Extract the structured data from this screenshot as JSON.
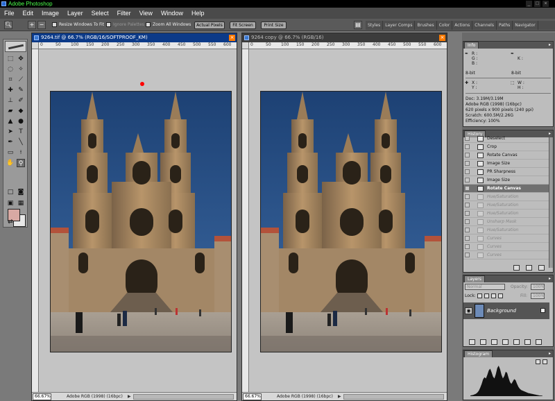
{
  "app": {
    "title": "Adobe Photoshop"
  },
  "menus": [
    "File",
    "Edit",
    "Image",
    "Layer",
    "Select",
    "Filter",
    "View",
    "Window",
    "Help"
  ],
  "options": {
    "resize_windows": "Resize Windows To Fit",
    "ignore_palettes": "Ignore Palettes",
    "zoom_all": "Zoom All Windows",
    "actual_pixels": "Actual Pixels",
    "fit_screen": "Fit Screen",
    "print_size": "Print Size"
  },
  "palette_well": [
    "Styles",
    "Layer Comps",
    "Brushes",
    "Color",
    "Actions",
    "Channels",
    "Paths",
    "Navigator"
  ],
  "docs": [
    {
      "title": "9264.tif @ 66.7% (RGB/16/SOFTPROOF_KM)",
      "zoom": "66.67%",
      "profile": "Adobe RGB (1998) (16bpc)",
      "ruler_ticks": [
        "0",
        "50",
        "100",
        "150",
        "200",
        "250",
        "300",
        "350",
        "400",
        "450",
        "500",
        "550",
        "600"
      ],
      "active": true
    },
    {
      "title": "9264 copy @ 66.7% (RGB/16)",
      "zoom": "66.67%",
      "profile": "Adobe RGB (1998) (16bpc)",
      "ruler_ticks": [
        "0",
        "50",
        "100",
        "150",
        "200",
        "250",
        "300",
        "350",
        "400",
        "450",
        "500",
        "550",
        "600"
      ],
      "active": false
    }
  ],
  "info": {
    "tab": "Info",
    "r": "R :",
    "g": "G :",
    "b": "B :",
    "k": "K :",
    "bit_left": "8-bit",
    "bit_right": "8-bit",
    "x": "X :",
    "y": "Y :",
    "w": "W :",
    "h": "H :",
    "doc": "Doc: 3.19M/3.19M",
    "profile": "Adobe RGB (1998) (16bpc)",
    "pixels": "620 pixels x 900 pixels (240 ppi)",
    "scratch": "Scratch: 600.5M/2.26G",
    "efficiency": "Efficiency: 100%"
  },
  "history": {
    "tab": "History",
    "items": [
      {
        "label": "Deselect",
        "state": "done"
      },
      {
        "label": "Crop",
        "state": "done"
      },
      {
        "label": "Rotate Canvas",
        "state": "done"
      },
      {
        "label": "Image Size",
        "state": "done"
      },
      {
        "label": "PR Sharpness",
        "state": "done"
      },
      {
        "label": "Image Size",
        "state": "done"
      },
      {
        "label": "Rotate Canvas",
        "state": "current"
      },
      {
        "label": "Hue/Saturation",
        "state": "undone"
      },
      {
        "label": "Hue/Saturation",
        "state": "undone"
      },
      {
        "label": "Hue/Saturation",
        "state": "undone"
      },
      {
        "label": "Unsharp Mask",
        "state": "undone"
      },
      {
        "label": "Hue/Saturation",
        "state": "undone"
      },
      {
        "label": "Curves",
        "state": "undone"
      },
      {
        "label": "Curves",
        "state": "undone"
      },
      {
        "label": "Curves",
        "state": "undone"
      }
    ]
  },
  "layers": {
    "tab": "Layers",
    "blend_mode": "Normal",
    "opacity_label": "Opacity:",
    "opacity": "100%",
    "lock_label": "Lock:",
    "fill_label": "Fill:",
    "fill": "100%",
    "layer_name": "Background"
  },
  "histogram": {
    "tab": "Histogram",
    "levels": [
      2,
      3,
      4,
      6,
      8,
      12,
      18,
      28,
      40,
      55,
      62,
      58,
      70,
      84,
      90,
      78,
      64,
      58,
      72,
      92,
      100,
      88,
      70,
      58,
      66,
      80,
      76,
      60,
      46,
      40,
      48,
      56,
      52,
      40,
      30,
      24,
      20,
      18,
      16,
      14,
      12,
      10,
      9,
      8,
      7,
      6,
      5,
      4,
      3,
      2,
      2,
      1
    ]
  },
  "colors": {
    "title_green": "#4cff4c",
    "foreground": "#d8a9a3",
    "background": "#e8e8e8",
    "active_doc_bar": "#0c3a88",
    "inactive_doc_bar": "#3c3c3c",
    "cursor_red": "#ff0000"
  },
  "icons": {
    "zoom_tool": "magnifier-icon",
    "hand_tool": "hand-icon"
  }
}
